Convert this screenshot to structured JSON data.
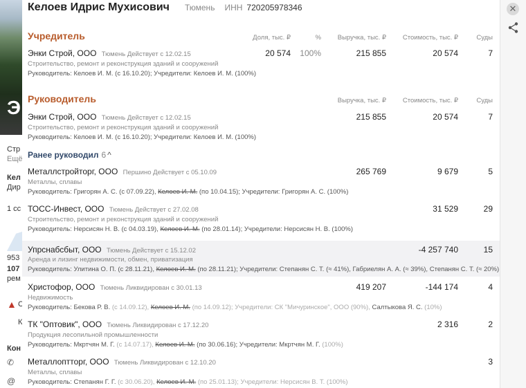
{
  "background": {
    "big_letter": "Э",
    "lines": [
      "Стр",
      "Ещё",
      "Кел",
      "Дир",
      "1 сс",
      "953",
      "107",
      "рем",
      "С",
      "К",
      "Кон"
    ]
  },
  "header": {
    "name": "Келоев Идрис Мухисович",
    "city": "Тюмень",
    "inn_label": "ИНН",
    "inn": "720205978346"
  },
  "columns": {
    "share": "Доля, тыс. ₽",
    "pct": "%",
    "revenue": "Выручка, тыс. ₽",
    "value": "Стоимость, тыс. ₽",
    "courts": "Суды"
  },
  "founder": {
    "title": "Учредитель",
    "rows": [
      {
        "company": "Энки Строй, ООО",
        "meta": "Тюмень  Действует с 12.02.15",
        "activity": "Строительство, ремонт и реконструкция зданий и сооружений",
        "people": "Руководитель: Келоев И. М. (с 16.10.20); Учредители: Келоев И. М. (100%)",
        "share": "20 574",
        "pct": "100%",
        "revenue": "215 855",
        "value": "20 574",
        "courts": "7"
      }
    ]
  },
  "director": {
    "title": "Руководитель",
    "rows": [
      {
        "company": "Энки Строй, ООО",
        "meta": "Тюмень  Действует с 12.02.15",
        "activity": "Строительство, ремонт и реконструкция зданий и сооружений",
        "people": "Руководитель: Келоев И. М. (с 16.10.20); Учредители: Келоев И. М. (100%)",
        "revenue": "215 855",
        "value": "20 574",
        "courts": "7"
      }
    ]
  },
  "earlier": {
    "label": "Ранее руководил",
    "count": "6",
    "chevron": "^",
    "rows": [
      {
        "company": "Металлстройторг, ООО",
        "meta": "Першино  Действует с 05.10.09",
        "activity": "Металлы, сплавы",
        "p1": "Руководитель: Григорян А. С. (с 07.09.22),",
        "p2": "Келоев И. М.",
        "p3": "(по 10.04.15); Учредители: Григорян А. С. (100%)",
        "revenue": "265 769",
        "value": "9 679",
        "courts": "5"
      },
      {
        "company": "ТОСС-Инвест, ООО",
        "meta": "Тюмень  Действует с 27.02.08",
        "activity": "Строительство, ремонт и реконструкция зданий и сооружений",
        "p1": "Руководитель: Нерсисян Н. В. (с 04.03.19),",
        "p2": "Келоев И. М.",
        "p3": "(по 28.01.14); Учредители: Нерсисян Н. В. (100%)",
        "revenue": "",
        "value": "31 529",
        "courts": "29"
      },
      {
        "company": "Упрснабсбыт, ООО",
        "meta": "Тюмень  Действует с 15.12.02",
        "activity": "Аренда и лизинг недвижимости, обмен, приватизация",
        "p1": "Руководитель: Улитина О. П. (с 28.11.21),",
        "p2": "Келоев И. М.",
        "p3": "(по 28.11.21); Учредители: Степанян С. Т. (≈ 41%), Габриелян А. А. (≈ 39%), Степанян С. Т. (≈ 20%)",
        "revenue": "",
        "value": "-4 257 740",
        "courts": "15"
      },
      {
        "company": "Христофор, ООО",
        "meta": "Тюмень  Ликвидирован с 30.01.13",
        "activity": "Недвижимость",
        "p1": "Руководитель: Бекова Р. В.",
        "p1b": "(с 14.09.12),",
        "p2": "Келоев И. М.",
        "p3": "(по 14.09.12); Учредители: СК \"Мичуринское\", ООО",
        "p3b": "(90%),",
        "p3c": "Салтыкова Я. С.",
        "p3d": "(10%)",
        "revenue": "419 207",
        "value": "-144 174",
        "courts": "4"
      },
      {
        "company": "ТК \"Оптовик\", ООО",
        "meta": "Тюмень  Ликвидирован с 17.12.20",
        "activity": "Продукция лесопильной промышленности",
        "p1": "Руководитель: Мкртчян М. Г.",
        "p1b": "(с 14.07.17),",
        "p2": "Келоев И. М.",
        "p3": "(по 30.06.16); Учредители: Мкртчян М. Г.",
        "p3b": "(100%)",
        "revenue": "",
        "value": "2 316",
        "courts": "2"
      },
      {
        "company": "Металлоптторг, ООО",
        "meta": "Тюмень  Ликвидирован с 12.10.20",
        "activity": "Металлы, сплавы",
        "p1": "Руководитель: Степанян Г. Г.",
        "p1b": "(с 30.06.20),",
        "p2": "Келоев И. М.",
        "p3": "(по 25.01.13); Учредители: Нерсисян В. Т.",
        "p3b": "(100%)",
        "revenue": "",
        "value": "",
        "courts": "3"
      }
    ]
  },
  "icons": {
    "close": "close-icon",
    "share": "share-icon"
  }
}
